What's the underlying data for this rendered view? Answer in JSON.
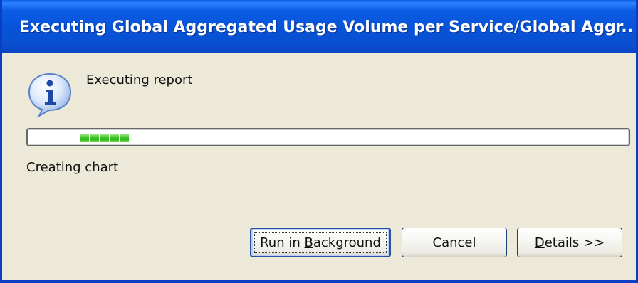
{
  "window": {
    "title": "Executing Global Aggregated Usage Volume per Service/Global Aggr..."
  },
  "content": {
    "message": "Executing report",
    "status": "Creating chart",
    "icon": "info-icon",
    "progress_blocks": 5
  },
  "buttons": {
    "run_in_background": {
      "pre": "Run in ",
      "mnemonic": "B",
      "post": "ackground"
    },
    "cancel": {
      "label": "Cancel"
    },
    "details": {
      "pre": "",
      "mnemonic": "D",
      "post": "etails >>"
    }
  },
  "colors": {
    "titlebar": "#0653d9",
    "dialog_bg": "#ece9d8",
    "progress_fill": "#2fb81b"
  }
}
